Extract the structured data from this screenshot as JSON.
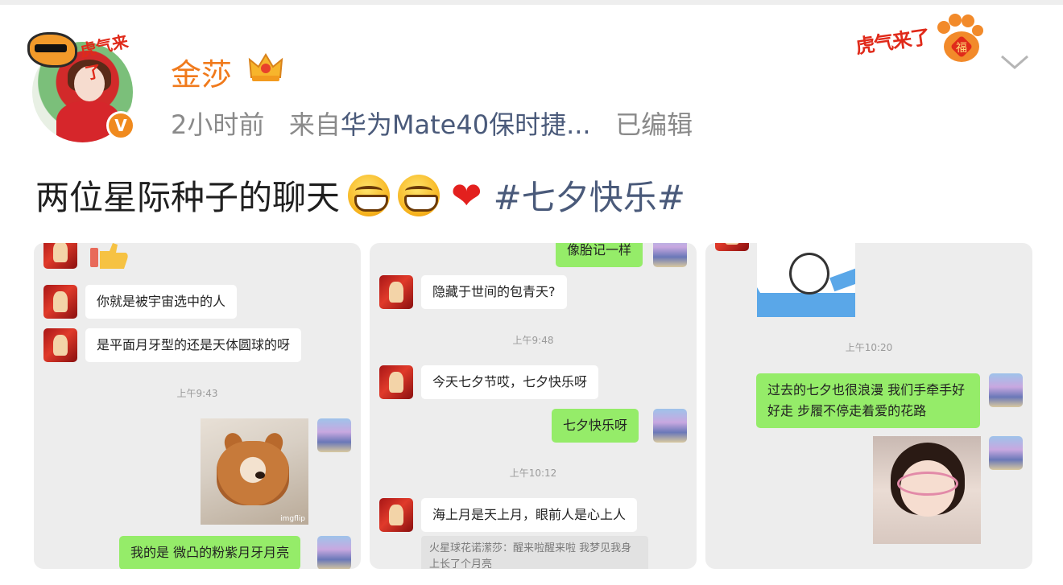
{
  "post": {
    "username": "金莎",
    "time": "2小时前",
    "source_prefix": "来自",
    "source": "华为Mate40保时捷...",
    "edited": "已编辑",
    "text": "两位星际种子的聊天",
    "hashtag": "#七夕快乐#"
  },
  "avatar": {
    "badge_text": "虎气来了",
    "verify_mark": "V"
  },
  "header_stamp": {
    "text": "虎气来了",
    "paw_text": "福"
  },
  "icons": [
    "crown-icon",
    "verified-v-icon",
    "chevron-down-icon",
    "grin-emoji-icon",
    "red-heart-icon",
    "tiger-paw-icon"
  ],
  "colors": {
    "username": "#f07a1c",
    "link": "#4a5a7a",
    "meta": "#8a8a8a",
    "chat_bg": "#ededed",
    "bubble_self": "#95ec69"
  },
  "chat1": {
    "msg1": "你就是被宇宙选中的人",
    "msg2": "是平面月牙型的还是天体圆球的呀",
    "time1": "上午9:43",
    "msg3": "我的是 微凸的粉紫月牙月亮",
    "watermark": "imgflip"
  },
  "chat2": {
    "msg0": "像胎记一样",
    "msg1": "隐藏于世间的包青天?",
    "time1": "上午9:48",
    "msg2": "今天七夕节哎，七夕快乐呀",
    "msg3": "七夕快乐呀",
    "time2": "上午10:12",
    "msg4": "海上月是天上月，眼前人是心上人",
    "quote": "火星球花诺潆莎：醒来啦醒来啦 我梦见我身上长了个月亮"
  },
  "chat3": {
    "time1": "上午10:20",
    "msg1": "过去的七夕也很浪漫 我们手牵手好好走 步履不停走着爱的花路"
  }
}
